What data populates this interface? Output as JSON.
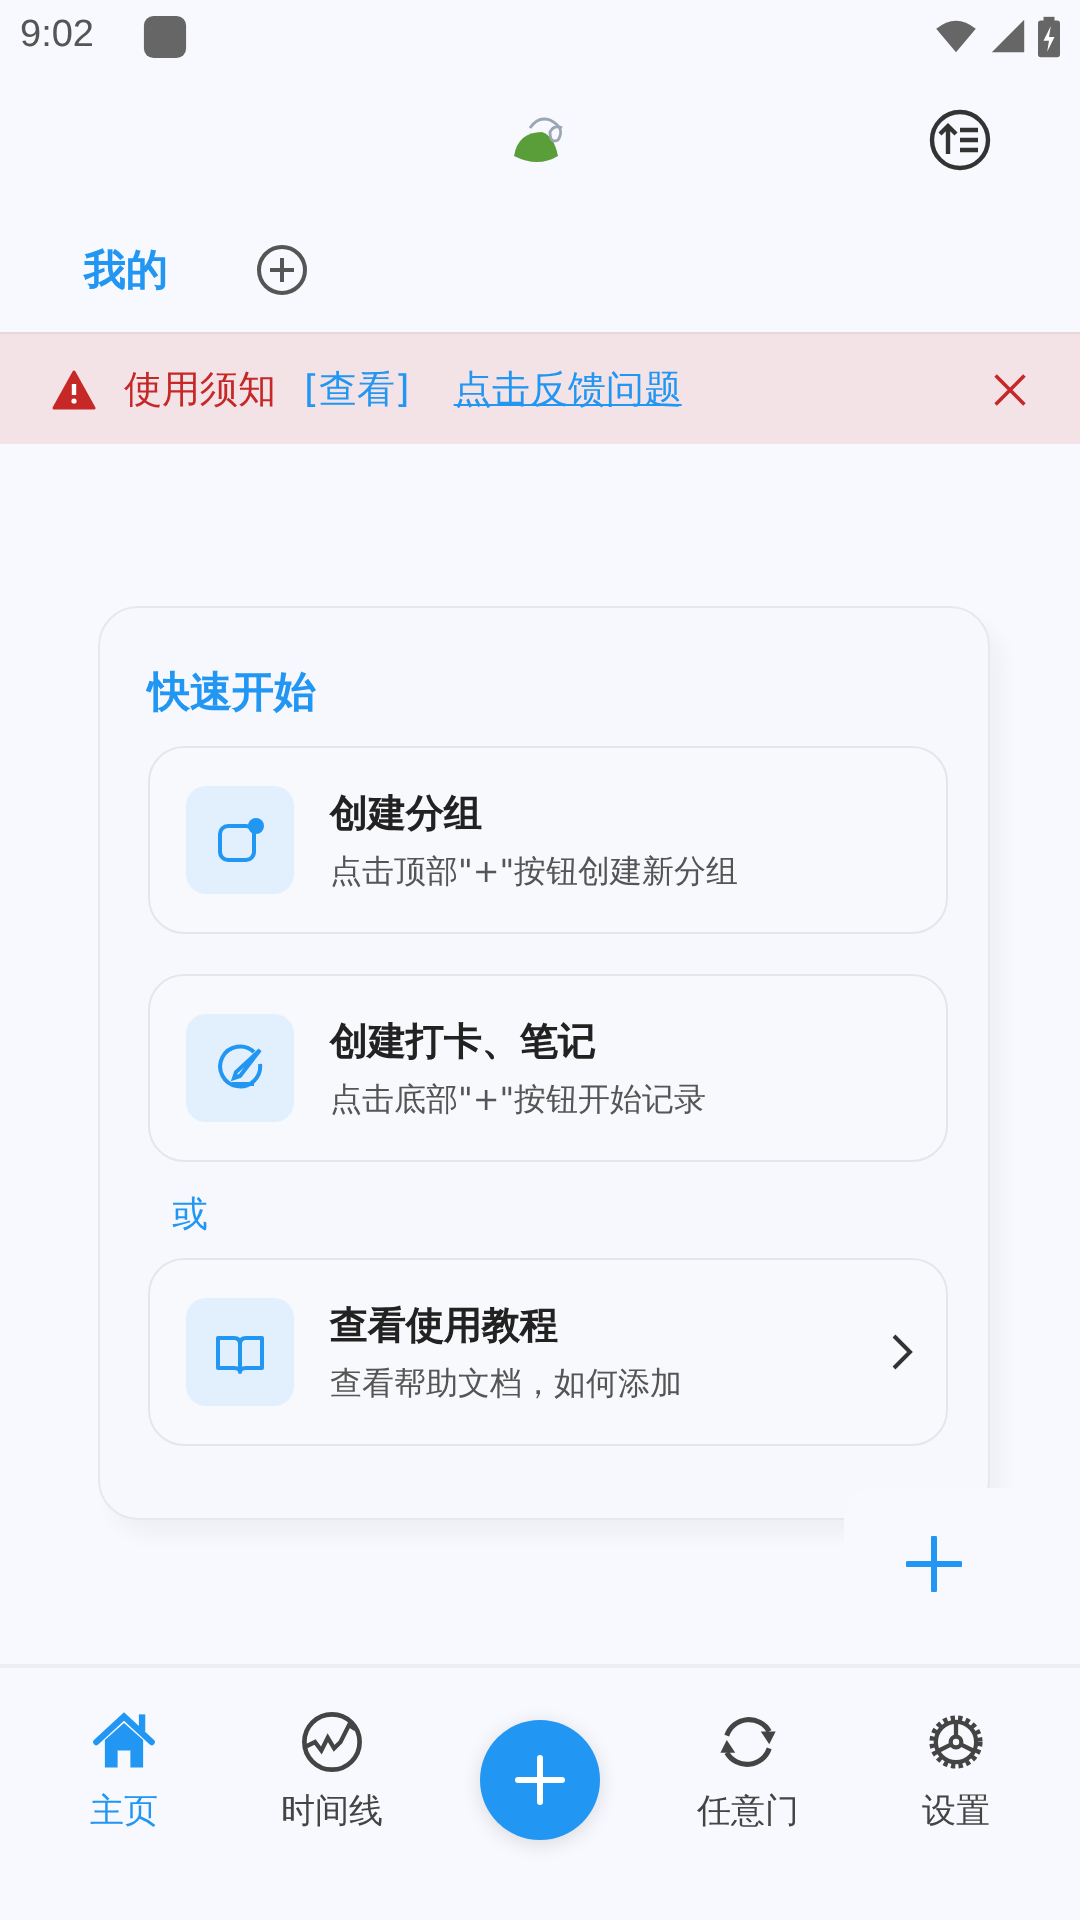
{
  "status_bar": {
    "time": "9:02"
  },
  "tabs": [
    {
      "label": "我的",
      "selected": true
    }
  ],
  "notice": {
    "title": "使用须知",
    "view_link": "[查看]",
    "feedback_link": "点击反馈问题"
  },
  "quick_start": {
    "title": "快速开始",
    "items": [
      {
        "kind": "group",
        "title": "创建分组",
        "subtitle": "点击顶部\"+\"按钮创建新分组",
        "chevron": false
      },
      {
        "kind": "note",
        "title": "创建打卡、笔记",
        "subtitle": "点击底部\"+\"按钮开始记录",
        "chevron": false
      },
      {
        "kind": "separator",
        "label": "或"
      },
      {
        "kind": "tutorial",
        "title": "查看使用教程",
        "subtitle": "查看帮助文档，如何添加",
        "chevron": true
      }
    ]
  },
  "bottom_nav": [
    {
      "kind": "home",
      "label": "主页",
      "selected": true
    },
    {
      "kind": "timeline",
      "label": "时间线",
      "selected": false
    },
    {
      "kind": "fab"
    },
    {
      "kind": "portal",
      "label": "任意门",
      "selected": false
    },
    {
      "kind": "settings",
      "label": "设置",
      "selected": false
    }
  ]
}
